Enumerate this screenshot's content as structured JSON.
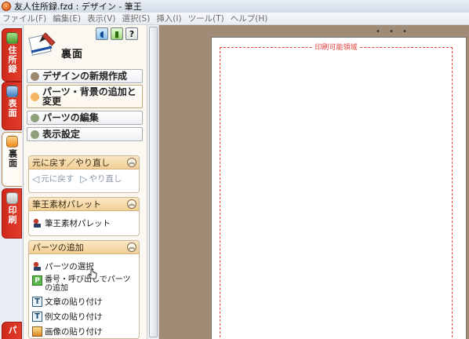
{
  "titlebar": {
    "title": "友人住所録.fzd : デザイン - 筆王"
  },
  "menubar": {
    "items": [
      "ファイル(F)",
      "編集(E)",
      "表示(V)",
      "選択(S)",
      "挿入(I)",
      "ツール(T)",
      "ヘルプ(H)"
    ]
  },
  "tabs": [
    {
      "label": "住所録"
    },
    {
      "label": "表面"
    },
    {
      "label": "裏面"
    },
    {
      "label": "印刷"
    },
    {
      "label": "パ"
    }
  ],
  "panel": {
    "title": "裏面",
    "icons": {
      "sound": "speaker-icon",
      "guide": "book-icon",
      "help": "?"
    },
    "buttons": [
      {
        "label": "デザインの新規作成",
        "color": "#a08770"
      },
      {
        "label": "パーツ・背景の追加と変更",
        "color": "#f3b562"
      },
      {
        "label": "パーツの編集",
        "color": "#8ea07a"
      },
      {
        "label": "表示設定",
        "color": "#8ea07a"
      }
    ],
    "sections": {
      "undo": {
        "title": "元に戻す／やり直し",
        "undo_label": "元に戻す",
        "redo_label": "やり直し"
      },
      "palette": {
        "title": "筆王素材パレット",
        "item_label": "筆王素材パレット"
      },
      "add_parts": {
        "title": "パーツの追加",
        "items": [
          {
            "label": "パーツの選択"
          },
          {
            "label": "番号・呼び出しでパーツの追加"
          },
          {
            "label": "文章の貼り付け"
          },
          {
            "label": "例文の貼り付け"
          },
          {
            "label": "画像の貼り付け"
          }
        ]
      }
    }
  },
  "canvas": {
    "print_area_label": "印刷可能領域",
    "ruler_dots": "• • •"
  },
  "colors": {
    "tab_red": "#d8301f",
    "print_line": "#e2413a",
    "canvas_bg": "#a08b76"
  }
}
